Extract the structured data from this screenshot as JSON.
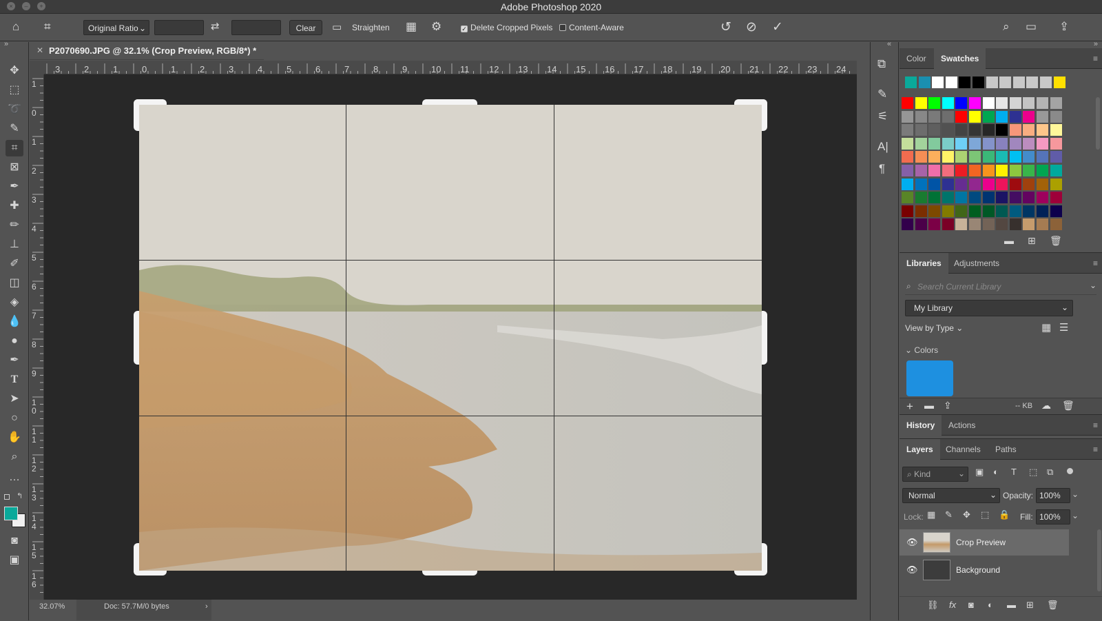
{
  "app": {
    "title": "Adobe Photoshop 2020"
  },
  "options": {
    "ratio": "Original Ratio",
    "clear": "Clear",
    "straighten": "Straighten",
    "delete_cropped": "Delete Cropped Pixels",
    "delete_cropped_checked": true,
    "content_aware": "Content-Aware",
    "content_aware_checked": false
  },
  "document": {
    "tab_title": "P2070690.JPG @ 32.1% (Crop Preview, RGB/8*) *",
    "h_ruler": [
      "3",
      "2",
      "1",
      "0",
      "1",
      "2",
      "3",
      "4",
      "5",
      "6",
      "7",
      "8",
      "9",
      "10",
      "11",
      "12",
      "13",
      "14",
      "15",
      "16",
      "17",
      "18",
      "19",
      "20",
      "21",
      "22",
      "23",
      "24"
    ],
    "v_ruler": [
      "1",
      "0",
      "1",
      "2",
      "3",
      "4",
      "5",
      "6",
      "7",
      "8",
      "9",
      "1\n0",
      "1\n1",
      "1\n2",
      "1\n3",
      "1\n4",
      "1\n5",
      "1\n6"
    ]
  },
  "status": {
    "zoom": "32.07%",
    "doc": "Doc: 57.7M/0 bytes"
  },
  "color_panel": {
    "tabs": [
      "Color",
      "Swatches"
    ],
    "active_tab": "Swatches",
    "recent": [
      "#0aa99a",
      "#1a8fb0",
      "#ffffff",
      "#ffffff",
      "#000000",
      "#000000",
      "#c8c8c8",
      "#c8c8c8",
      "#c8c8c8",
      "#c8c8c8",
      "#c8c8c8",
      "#ffe000"
    ],
    "grid": [
      [
        "#ff0000",
        "#ffff00",
        "#00ff00",
        "#00ffff",
        "#0000ff",
        "#ff00ff",
        "#ffffff",
        "#e6e6e6",
        "#d4d4d4",
        "#c4c4c4",
        "#b4b4b4",
        "#a4a4a4"
      ],
      [
        "#969696",
        "#888888",
        "#7a7a7a",
        "#6e6e6e",
        "#ff0000",
        "#ffff00",
        "#00a651",
        "#00aeef",
        "#2e3192",
        "#ec008c",
        "#999999",
        "#8a8a8a"
      ],
      [
        "#7b7b7b",
        "#6d6d6d",
        "#5f5f5f",
        "#515151",
        "#434343",
        "#353535",
        "#272727",
        "#000000",
        "#f7977a",
        "#f9ad81",
        "#fdc68a",
        "#fff79a"
      ],
      [
        "#c4df9b",
        "#a3d39c",
        "#82ca9d",
        "#7bcdc8",
        "#6ecff6",
        "#7ea7d8",
        "#8493ca",
        "#8882be",
        "#a187be",
        "#bc8dbf",
        "#f49ac2",
        "#f6989d"
      ],
      [
        "#f26c4f",
        "#f68e55",
        "#fbaf5c",
        "#fff467",
        "#acd372",
        "#7cc576",
        "#3bb878",
        "#1abbb4",
        "#00bff3",
        "#438ccb",
        "#5574b9",
        "#605ca8"
      ],
      [
        "#8560a8",
        "#a763a8",
        "#f06eaa",
        "#f26d7d",
        "#ed1c24",
        "#f26522",
        "#f7941d",
        "#fff200",
        "#8dc73f",
        "#39b54a",
        "#00a651",
        "#00a99d"
      ],
      [
        "#00aeef",
        "#0072bc",
        "#0054a6",
        "#2e3192",
        "#662d91",
        "#92278f",
        "#ec008c",
        "#ed145b",
        "#9e0b0f",
        "#a0410d",
        "#a36209",
        "#aba000"
      ],
      [
        "#598527",
        "#197b30",
        "#007236",
        "#00746b",
        "#0076a3",
        "#004a80",
        "#003471",
        "#1b1464",
        "#440e62",
        "#630460",
        "#9e005d",
        "#9e0039"
      ],
      [
        "#790000",
        "#7b2e00",
        "#7d4900",
        "#827b00",
        "#406618",
        "#005e20",
        "#005826",
        "#005952",
        "#005b7f",
        "#003663",
        "#002157",
        "#0d004c"
      ],
      [
        "#32004b",
        "#4b0049",
        "#7b0046",
        "#7a0026",
        "#c7b299",
        "#998675",
        "#736357",
        "#534741",
        "#37302d",
        "#c69c6d",
        "#a67c52",
        "#8c6239"
      ]
    ]
  },
  "libraries": {
    "tabs": [
      "Libraries",
      "Adjustments"
    ],
    "search_placeholder": "Search Current Library",
    "library": "My Library",
    "view_by": "View by Type",
    "section": "Colors",
    "swatch": "#1e90e0",
    "size": "-- KB"
  },
  "history": {
    "tabs": [
      "History",
      "Actions"
    ]
  },
  "layers": {
    "tabs": [
      "Layers",
      "Channels",
      "Paths"
    ],
    "kind": "Kind",
    "blend": "Normal",
    "opacity_label": "Opacity:",
    "opacity": "100%",
    "lock_label": "Lock:",
    "fill_label": "Fill:",
    "fill": "100%",
    "items": [
      {
        "name": "Crop Preview",
        "selected": true
      },
      {
        "name": "Background",
        "selected": false
      }
    ]
  }
}
